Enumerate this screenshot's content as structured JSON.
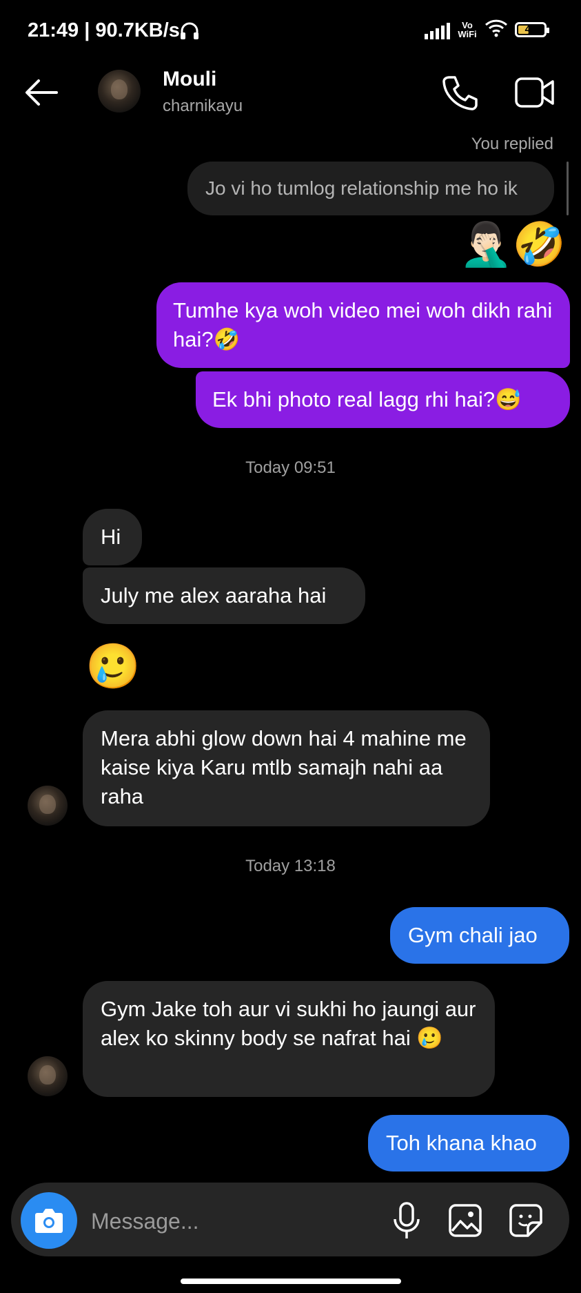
{
  "status_bar": {
    "time": "21:49 | 90.7KB/s",
    "network_label": "Vo\nWiFi",
    "battery": "41",
    "battery_level": 0.41
  },
  "header": {
    "name": "Mouli",
    "username": "charnikayu"
  },
  "messages": {
    "you_replied_label": "You replied",
    "reply_quote": "Jo vi ho tumlog relationship me ho ik",
    "reaction_emojis": "🤦🏻‍♂️🤣",
    "sent_1": "Tumhe kya woh video mei woh dikh rahi hai?🤣",
    "sent_2": "Ek bhi photo real lagg rhi hai?😅",
    "timestamp_1": "Today 09:51",
    "recv_1": "Hi",
    "recv_2": "July me alex aaraha hai",
    "recv_emoji": "🥲",
    "recv_3": "Mera abhi glow down hai 4 mahine me kaise kiya Karu mtlb samajh nahi aa raha",
    "timestamp_2": "Today 13:18",
    "sent_3": "Gym chali jao",
    "recv_4": "Gym Jake toh aur vi sukhi ho jaungi aur alex ko skinny body se nafrat hai 🥲",
    "sent_4": "Toh khana khao"
  },
  "composer": {
    "placeholder": "Message..."
  },
  "colors": {
    "background": "#000000",
    "sent_purple": "#8a1de3",
    "sent_blue": "#2a73e8",
    "received": "#262626",
    "camera_button": "#2a8cf2"
  }
}
